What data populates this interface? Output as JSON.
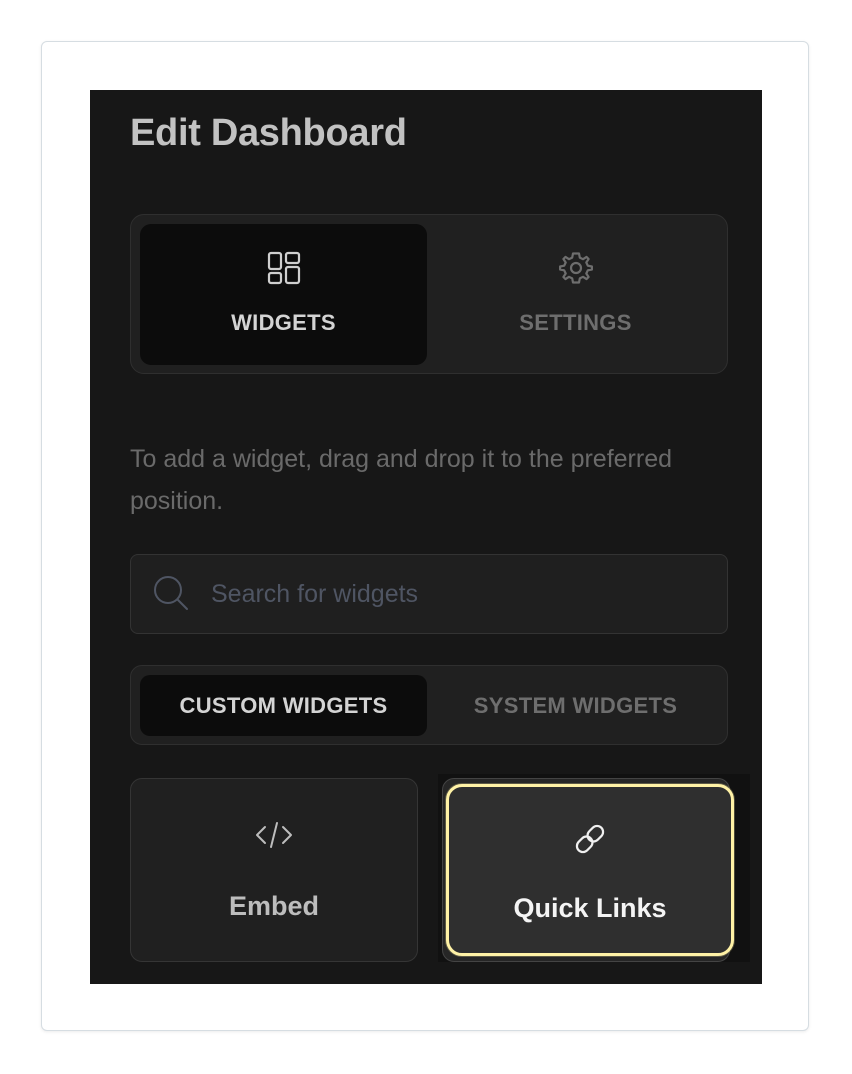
{
  "panel": {
    "title": "Edit Dashboard"
  },
  "mode_tabs": [
    {
      "label": "WIDGETS",
      "icon": "widgets-grid-icon",
      "active": true
    },
    {
      "label": "SETTINGS",
      "icon": "gear-icon",
      "active": false
    }
  ],
  "instructions": "To add a widget, drag and drop it to the preferred position.",
  "search": {
    "placeholder": "Search for widgets",
    "value": ""
  },
  "widget_tabs": [
    {
      "label": "CUSTOM WIDGETS",
      "active": true
    },
    {
      "label": "SYSTEM WIDGETS",
      "active": false
    }
  ],
  "widgets": [
    {
      "label": "Embed",
      "icon": "code-icon",
      "selected": false
    },
    {
      "label": "Quick Links",
      "icon": "link-icon",
      "selected": true
    }
  ],
  "colors": {
    "panel_background": "#171717",
    "active_tab_background": "#0c0c0c",
    "selected_outline": "#fff2a6"
  }
}
